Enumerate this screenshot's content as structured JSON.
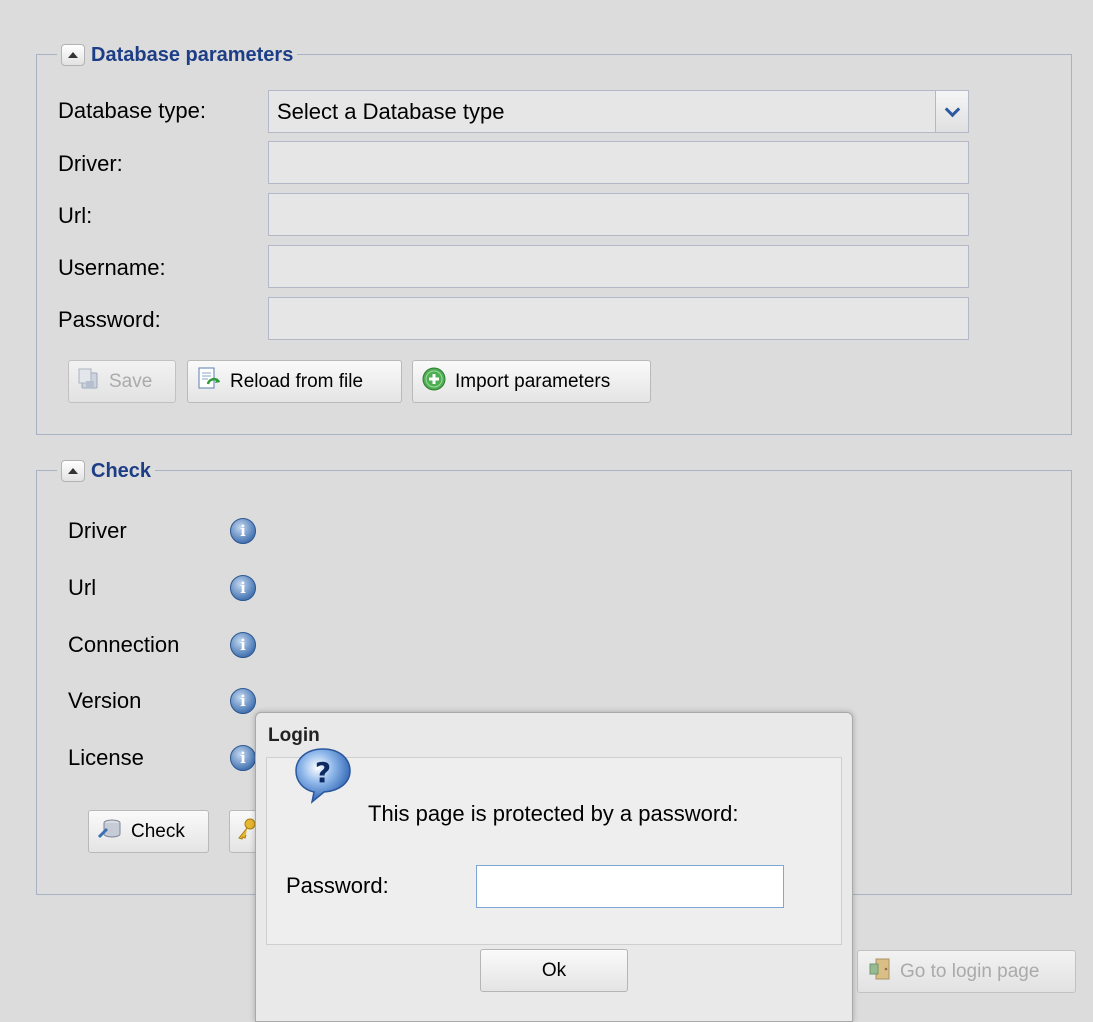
{
  "db_section": {
    "title": "Database parameters",
    "db_type_label": "Database type:",
    "db_type_value": "Select a Database type",
    "driver_label": "Driver:",
    "url_label": "Url:",
    "username_label": "Username:",
    "password_label": "Password:",
    "buttons": {
      "save": "Save",
      "reload": "Reload from file",
      "import": "Import parameters"
    }
  },
  "check_section": {
    "title": "Check",
    "items": [
      "Driver",
      "Url",
      "Connection",
      "Version",
      "License"
    ],
    "check_button": "Check"
  },
  "login_page_button": "Go to login page",
  "dialog": {
    "title": "Login",
    "message": "This page is protected by a password:",
    "password_label": "Password:",
    "password_value": "",
    "ok_button": "Ok"
  },
  "colors": {
    "section_title": "#1d3e87",
    "background": "#dcdcdc",
    "info_icon": "#4a78b5"
  }
}
